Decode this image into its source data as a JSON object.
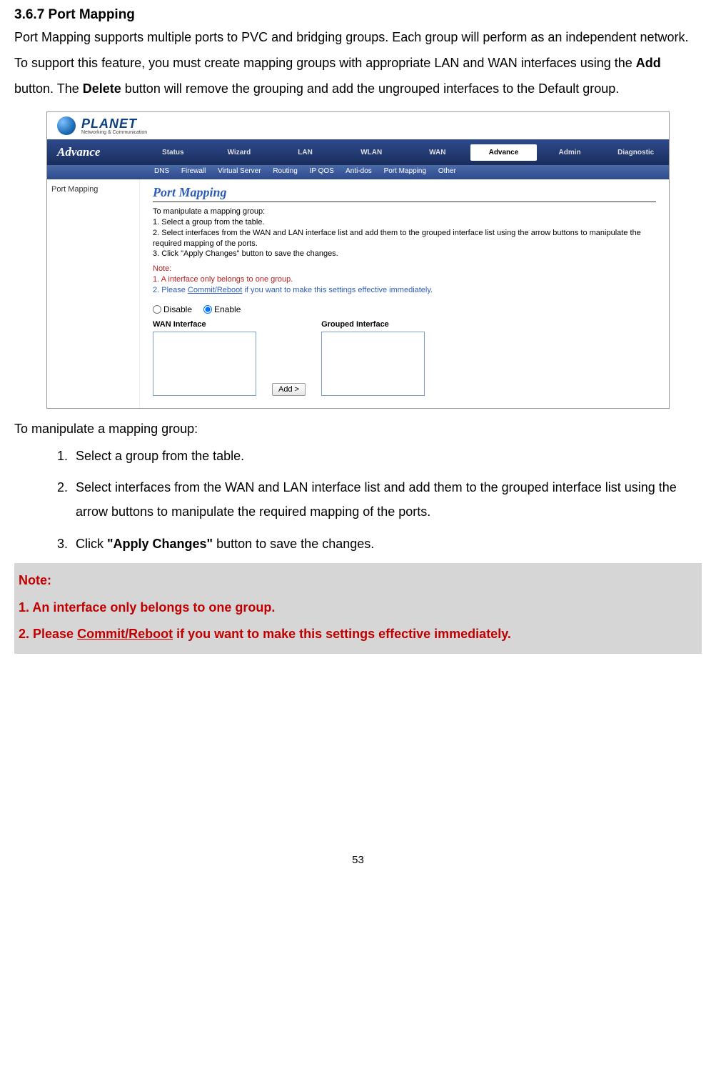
{
  "doc": {
    "section_heading": "3.6.7 Port Mapping",
    "intro_p1": "Port Mapping supports multiple ports to PVC and bridging groups. Each group will perform as an independent network. To support this feature, you must create mapping groups with appropriate LAN and WAN interfaces using the ",
    "intro_add": "Add",
    "intro_p2": " button. The ",
    "intro_delete": "Delete",
    "intro_p3": " button will remove the grouping and add the ungrouped interfaces to the Default group.",
    "manipulate_heading": "To manipulate a mapping group:",
    "steps": [
      "Select a group from the table.",
      "Select interfaces from the WAN and LAN interface list and add them to the grouped interface list using the arrow buttons to manipulate the required mapping of the ports.",
      "Click \"Apply Changes\" button to save the changes."
    ],
    "step3_prefix": "Click ",
    "step3_bold": "\"Apply Changes\"",
    "step3_suffix": " button to save the changes.",
    "note_title": "Note:",
    "note_lines": {
      "n1": "1. An interface only belongs to one group.",
      "n2_a": "2. Please ",
      "n2_cr": "Commit/Reboot",
      "n2_b": " if you want to make this settings effective immediately."
    },
    "page_number": "53"
  },
  "ui": {
    "logo_main": "PLANET",
    "logo_sub": "Networking & Communication",
    "brand": "Advance",
    "nav": {
      "items": [
        "Status",
        "Wizard",
        "LAN",
        "WLAN",
        "WAN",
        "Advance",
        "Admin",
        "Diagnostic"
      ],
      "active_index": 5
    },
    "subnav": [
      "DNS",
      "Firewall",
      "Virtual Server",
      "Routing",
      "IP QOS",
      "Anti-dos",
      "Port Mapping",
      "Other"
    ],
    "sidebar_item": "Port Mapping",
    "panel_title": "Port Mapping",
    "instructions": {
      "l0": "To manipulate a mapping group:",
      "l1": "1. Select a group from the table.",
      "l2": "2. Select interfaces from the WAN and LAN interface list and add them to the grouped interface list using the arrow buttons to manipulate the required mapping of the ports.",
      "l3": "3. Click \"Apply Changes\" button to save the changes.",
      "note": "Note:",
      "nl1": "1. A interface only belongs to one group.",
      "nl2a": "2. Please ",
      "nl2cr": "Commit/Reboot",
      "nl2b": " if you want to make this settings effective immediately."
    },
    "radio": {
      "disable": "Disable",
      "enable": "Enable"
    },
    "iface": {
      "wan_label": "WAN Interface",
      "grouped_label": "Grouped Interface",
      "add_btn": "Add >"
    }
  }
}
